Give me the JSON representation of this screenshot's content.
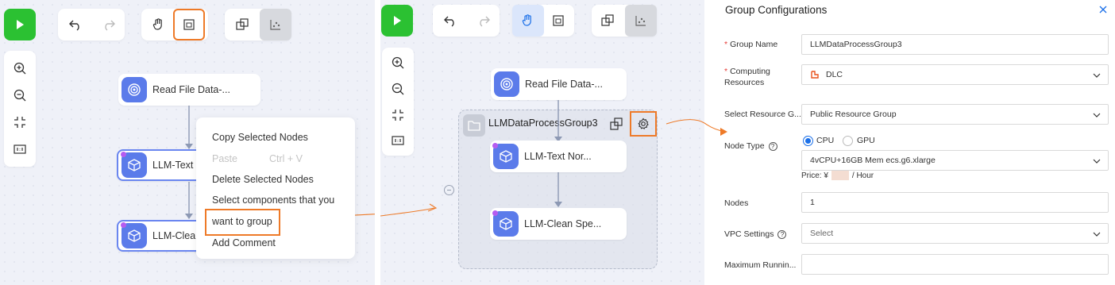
{
  "left_panel": {
    "nodes": [
      {
        "label": "Read File Data-..."
      },
      {
        "label": "LLM-Text N"
      },
      {
        "label": "LLM-Clean"
      }
    ],
    "context_menu": {
      "items": [
        {
          "label": "Copy Selected Nodes"
        },
        {
          "label": "Paste",
          "shortcut": "Ctrl + V"
        },
        {
          "label": "Delete Selected Nodes"
        },
        {
          "label": "Select components that you"
        },
        {
          "label": "want to group"
        },
        {
          "label": "Add Comment"
        }
      ]
    }
  },
  "middle_panel": {
    "group_name": "LLMDataProcessGroup3",
    "nodes": [
      {
        "label": "Read File Data-..."
      },
      {
        "label": "LLM-Text Nor..."
      },
      {
        "label": "LLM-Clean Spe..."
      }
    ]
  },
  "form": {
    "title": "Group Configurations",
    "fields": {
      "group_name": {
        "label": "Group Name",
        "value": "LLMDataProcessGroup3"
      },
      "computing_resources": {
        "label": "Computing Resources",
        "value": "DLC"
      },
      "resource_group": {
        "label": "Select Resource G...",
        "value": "Public Resource Group"
      },
      "node_type": {
        "label": "Node Type",
        "option_cpu": "CPU",
        "option_gpu": "GPU",
        "value": "4vCPU+16GB Mem ecs.g6.xlarge",
        "price_prefix": "Price: ¥",
        "price_suffix": "/ Hour"
      },
      "nodes": {
        "label": "Nodes",
        "value": "1"
      },
      "vpc": {
        "label": "VPC Settings",
        "placeholder": "Select"
      },
      "max_running": {
        "label": "Maximum Runnin..."
      }
    }
  },
  "colors": {
    "accent": "#ee7a28",
    "run": "#2bc132",
    "node_icon": "#5b7bea",
    "selection": "#6a86f0",
    "radio": "#1a6fe8"
  }
}
